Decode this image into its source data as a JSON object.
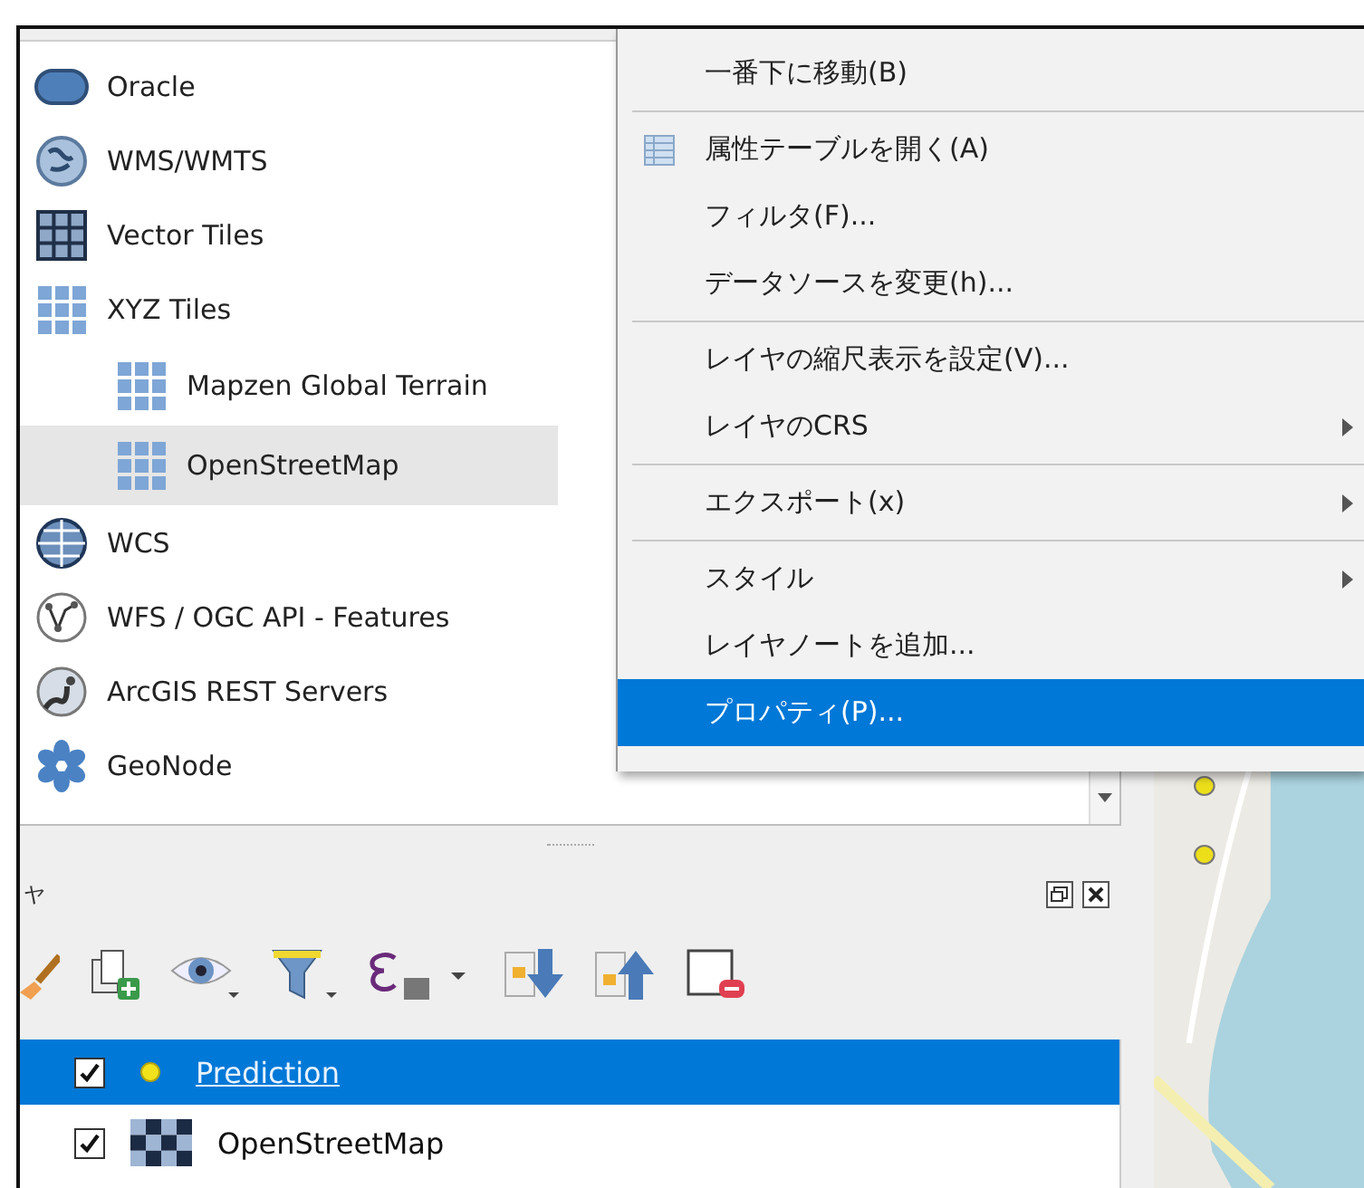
{
  "browser": {
    "items": [
      {
        "label": "Oracle",
        "kind": "oracle",
        "selected": false
      },
      {
        "label": "WMS/WMTS",
        "kind": "globe",
        "selected": false
      },
      {
        "label": "Vector Tiles",
        "kind": "vector-tiles",
        "selected": false
      },
      {
        "label": "XYZ Tiles",
        "kind": "xyz",
        "selected": false,
        "children": [
          {
            "label": "Mapzen Global Terrain",
            "kind": "xyz",
            "selected": false
          },
          {
            "label": "OpenStreetMap",
            "kind": "xyz",
            "selected": true
          }
        ]
      },
      {
        "label": "WCS",
        "kind": "wcs",
        "selected": false
      },
      {
        "label": "WFS / OGC API - Features",
        "kind": "wfs",
        "selected": false
      },
      {
        "label": "ArcGIS REST Servers",
        "kind": "arcgis",
        "selected": false
      },
      {
        "label": "GeoNode",
        "kind": "geonode",
        "selected": false
      }
    ]
  },
  "layers_panel": {
    "title": "ヤ",
    "layers": [
      {
        "name": "Prediction",
        "kind": "point",
        "checked": true,
        "selected": true
      },
      {
        "name": "OpenStreetMap",
        "kind": "raster",
        "checked": true,
        "selected": false
      }
    ]
  },
  "context_menu": {
    "groups": [
      [
        {
          "label": "一番下に移動(B)",
          "selected": false,
          "submenu": false
        }
      ],
      [
        {
          "label": "属性テーブルを開く(A)",
          "selected": false,
          "submenu": false,
          "icon": true
        },
        {
          "label": "フィルタ(F)...",
          "selected": false,
          "submenu": false
        },
        {
          "label": "データソースを変更(h)...",
          "selected": false,
          "submenu": false
        }
      ],
      [
        {
          "label": "レイヤの縮尺表示を設定(V)...",
          "selected": false,
          "submenu": false
        },
        {
          "label": "レイヤのCRS",
          "selected": false,
          "submenu": true
        }
      ],
      [
        {
          "label": "エクスポート(x)",
          "selected": false,
          "submenu": true
        }
      ],
      [
        {
          "label": "スタイル",
          "selected": false,
          "submenu": true
        },
        {
          "label": "レイヤノートを追加...",
          "selected": false,
          "submenu": false
        },
        {
          "label": "プロパティ(P)...",
          "selected": true,
          "submenu": false
        }
      ]
    ]
  }
}
